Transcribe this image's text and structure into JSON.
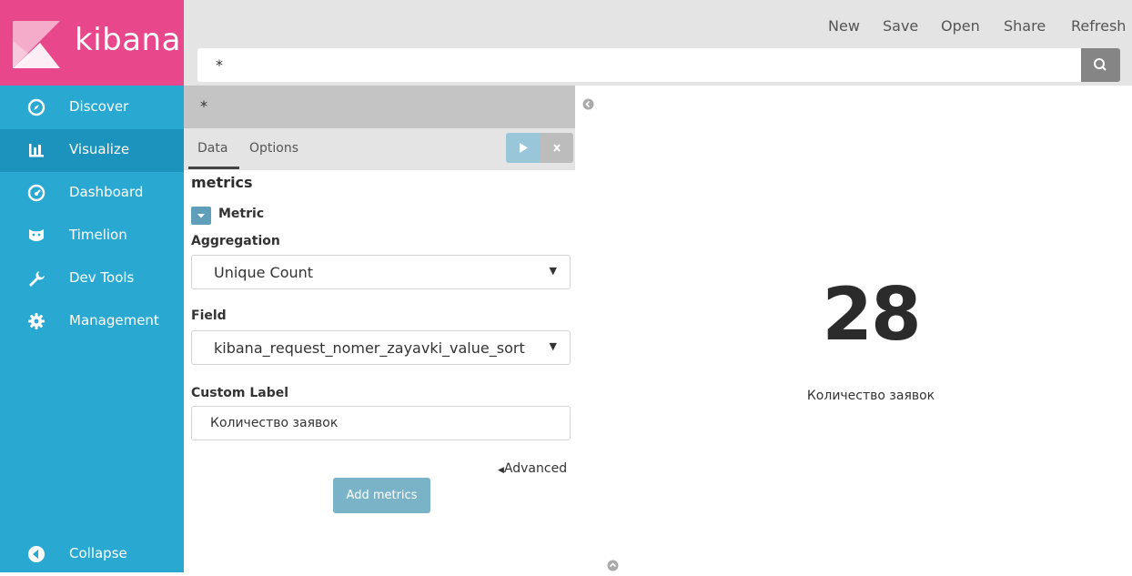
{
  "brand": {
    "name": "kibana",
    "accent": "#e8478b",
    "sidebar_color": "#29a9d2"
  },
  "sidebar": {
    "items": [
      {
        "label": "Discover",
        "icon": "compass-icon"
      },
      {
        "label": "Visualize",
        "icon": "bar-chart-icon"
      },
      {
        "label": "Dashboard",
        "icon": "dashboard-gauge-icon"
      },
      {
        "label": "Timelion",
        "icon": "timelion-cat-icon"
      },
      {
        "label": "Dev Tools",
        "icon": "wrench-icon"
      },
      {
        "label": "Management",
        "icon": "gear-icon"
      }
    ],
    "active": "Visualize",
    "collapse_label": "Collapse"
  },
  "topnav": {
    "new": "New",
    "save": "Save",
    "open": "Open",
    "share": "Share",
    "refresh": "Refresh"
  },
  "search": {
    "value": "*"
  },
  "editor": {
    "query": "*",
    "tabs": {
      "data": "Data",
      "options": "Options"
    },
    "section_title": "metrics",
    "metric_title": "Metric",
    "aggregation_label": "Aggregation",
    "aggregation_value": "Unique Count",
    "field_label": "Field",
    "field_value": "kibana_request_nomer_zayavki_value_sort",
    "custom_label_label": "Custom Label",
    "custom_label_value": "Количество заявок",
    "advanced_label": "Advanced",
    "add_metrics_label": "Add metrics"
  },
  "visualization": {
    "value": "28",
    "label": "Количество заявок"
  }
}
